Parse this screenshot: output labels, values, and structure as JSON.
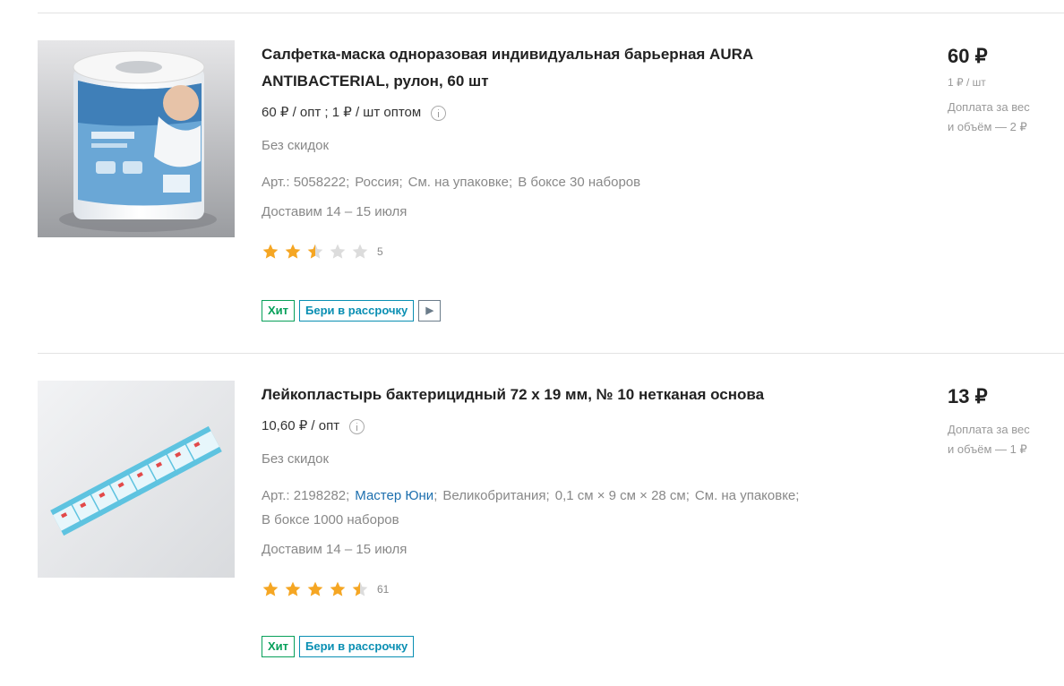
{
  "products": [
    {
      "title": "Салфетка-маска одноразовая индивидуальная барьерная AURA ANTIBACTERIAL, рулон, 60 шт",
      "price_line": "60 ₽ / опт ; 1 ₽ / шт оптом",
      "discount": "Без скидок",
      "specs": [
        "Арт.: 5058222;",
        "Россия;",
        "См. на упаковке;",
        "В боксе 30 наборов"
      ],
      "delivery": "Доставим 14 – 15 июля",
      "rating": 2.5,
      "rating_count": "5",
      "badges": [
        "Хит",
        "Бери в рассрочку"
      ],
      "price": "60 ₽",
      "unit_price": "1 ₽ / шт",
      "surcharge_1": "Доплата за вес",
      "surcharge_2": "и объём — 2 ₽"
    },
    {
      "title": "Лейкопластырь бактерицидный 72 х 19 мм, № 10 нетканая основа",
      "price_line": "10,60 ₽ / опт",
      "discount": "Без скидок",
      "specs_prefix": "Арт.: 2198282;",
      "brand_link": "Мастер Юни",
      "specs_rest": [
        "Великобритания;",
        "0,1 см × 9 см × 28 см;",
        "См. на упаковке;"
      ],
      "specs_line2": "В боксе 1000 наборов",
      "delivery": "Доставим 14 – 15 июля",
      "rating": 4.5,
      "rating_count": "61",
      "badges": [
        "Хит",
        "Бери в рассрочку"
      ],
      "price": "13 ₽",
      "surcharge_1": "Доплата за вес",
      "surcharge_2": "и объём — 1 ₽"
    }
  ],
  "colors": {
    "star": "#f5a623",
    "star_empty": "#dcdcdc",
    "hit": "#07a05a",
    "installment": "#0a8fb3",
    "link": "#1d6fae"
  },
  "icons": [
    "info-icon",
    "star-icon",
    "video-play-icon"
  ]
}
